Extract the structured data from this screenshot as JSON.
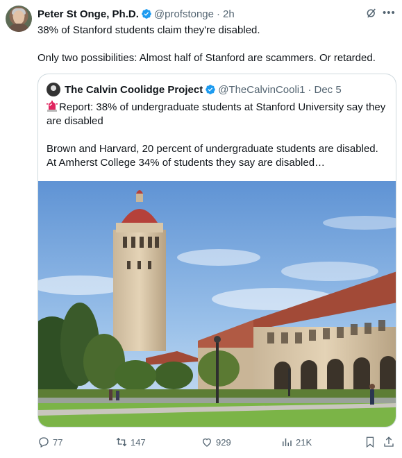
{
  "post": {
    "display_name": "Peter St Onge, Ph.D.",
    "handle": "@profstonge",
    "separator": "·",
    "time": "2h",
    "text_line1": "38% of Stanford students claim they're disabled.",
    "text_line2": "Only two possibilities: Almost half of Stanford are scammers. Or retarded."
  },
  "quote": {
    "display_name": "The Calvin Coolidge Project",
    "handle": "@TheCalvinCooli1",
    "separator": "·",
    "time": "Dec 5",
    "para1": "Report: 38% of undergraduate students at Stanford University say they are disabled",
    "para2": "Brown and Harvard, 20 percent of undergraduate students are disabled. At Amherst College 34% of students they say are disabled…",
    "emoji_icon": "police-siren-icon"
  },
  "actions": {
    "replies": "77",
    "reposts": "147",
    "likes": "929",
    "views": "21K"
  },
  "colors": {
    "verified": "#1d9bf0",
    "muted_text": "#536471",
    "border": "#cfd9de"
  }
}
